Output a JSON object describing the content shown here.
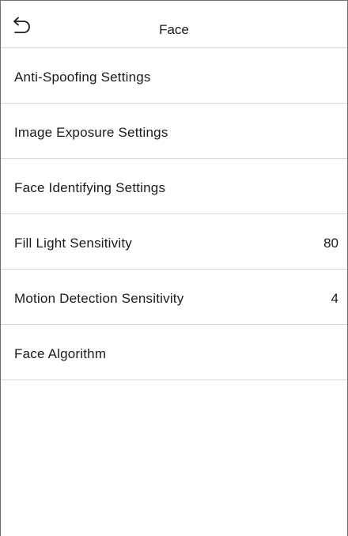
{
  "header": {
    "title": "Face",
    "back_icon": "back-arrow-icon"
  },
  "menu": {
    "items": [
      {
        "label": "Anti-Spoofing Settings",
        "value": ""
      },
      {
        "label": "Image Exposure Settings",
        "value": ""
      },
      {
        "label": "Face Identifying Settings",
        "value": ""
      },
      {
        "label": "Fill Light Sensitivity",
        "value": "80"
      },
      {
        "label": "Motion Detection Sensitivity",
        "value": "4"
      },
      {
        "label": "Face Algorithm",
        "value": ""
      }
    ]
  },
  "colors": {
    "background": "#ffffff",
    "text": "#1a1a1a",
    "divider": "#d9d9d9",
    "frame": "#6f6f6f"
  }
}
